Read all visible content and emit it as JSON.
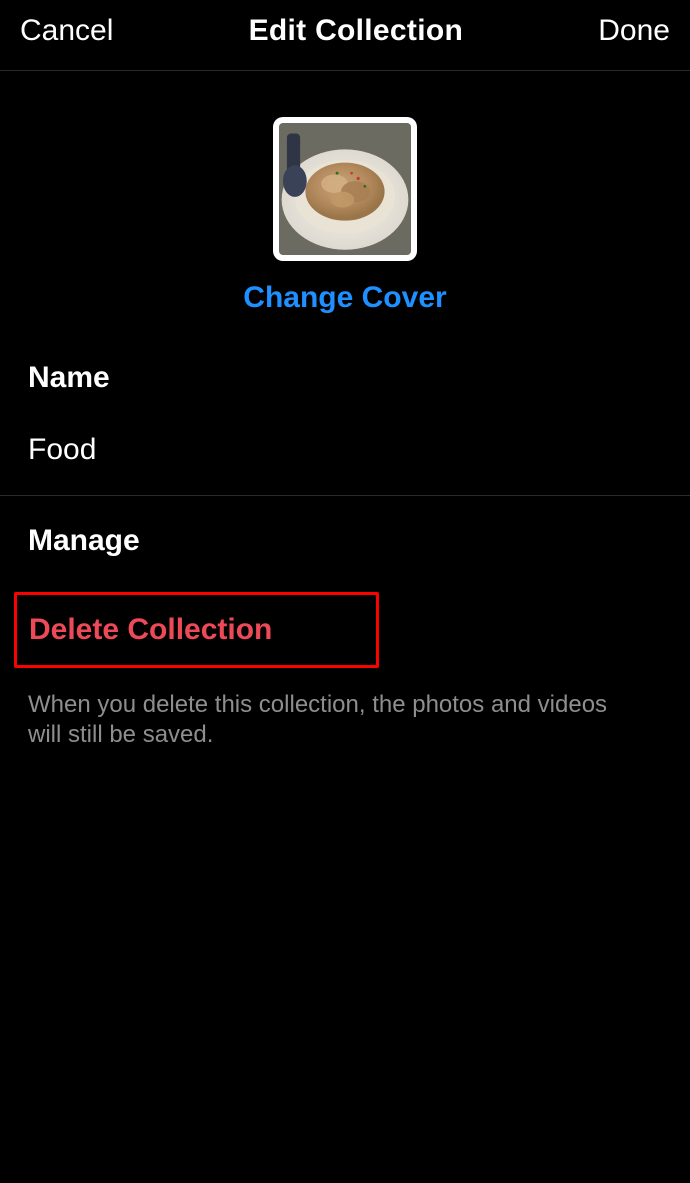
{
  "header": {
    "cancel_label": "Cancel",
    "title": "Edit Collection",
    "done_label": "Done"
  },
  "cover": {
    "change_label": "Change Cover"
  },
  "name_section": {
    "label": "Name",
    "value": "Food"
  },
  "manage_section": {
    "label": "Manage",
    "delete_label": "Delete Collection",
    "delete_hint": "When you delete this collection, the photos and videos will still be saved."
  },
  "colors": {
    "link": "#1e90ff",
    "destructive": "#ed4956",
    "highlight_box": "#ff0000"
  }
}
